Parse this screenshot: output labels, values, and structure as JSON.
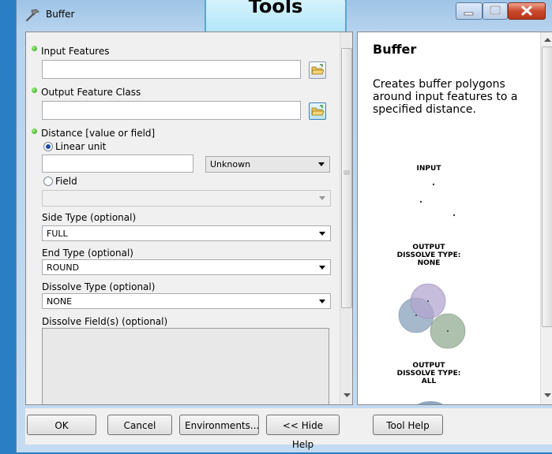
{
  "window": {
    "title": "Buffer"
  },
  "callout": {
    "text": "Tools"
  },
  "form": {
    "input_features": {
      "label": "Input Features",
      "value": ""
    },
    "output_feature_class": {
      "label": "Output Feature Class",
      "value": ""
    },
    "distance": {
      "label": "Distance [value or field]",
      "linear_unit_label": "Linear unit",
      "linear_unit_value": "",
      "unit_selected": "Unknown",
      "field_label": "Field",
      "field_value": "",
      "selected_option": "Linear unit"
    },
    "side_type": {
      "label": "Side Type (optional)",
      "value": "FULL"
    },
    "end_type": {
      "label": "End Type (optional)",
      "value": "ROUND"
    },
    "dissolve_type": {
      "label": "Dissolve Type (optional)",
      "value": "NONE"
    },
    "dissolve_fields": {
      "label": "Dissolve Field(s) (optional)"
    }
  },
  "help": {
    "title": "Buffer",
    "description": "Creates buffer polygons around input features to a specified distance.",
    "diagram": {
      "input_label": "INPUT",
      "output_none_label": "OUTPUT\nDISSOLVE TYPE:\nNONE",
      "output_all_label": "OUTPUT\nDISSOLVE TYPE:\nALL",
      "circle_colors": [
        "#b3a6cf",
        "#8ea6bf",
        "#9fb6a0"
      ]
    }
  },
  "buttons": {
    "ok": "OK",
    "cancel": "Cancel",
    "environments": "Environments...",
    "hide_help": "<< Hide Help",
    "tool_help": "Tool Help"
  },
  "colors": {
    "required_dot": "#2e9e19",
    "close_button": "#c94a2e",
    "callout_bg": "#a9e2f6"
  }
}
